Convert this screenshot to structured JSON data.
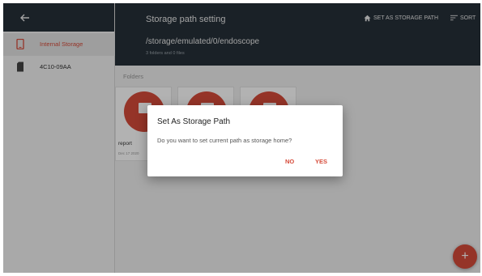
{
  "sidebar": {
    "items": [
      {
        "label": "Internal Storage",
        "icon": "phone-icon",
        "active": true
      },
      {
        "label": "4C10-09AA",
        "icon": "sd-card-icon",
        "active": false
      }
    ]
  },
  "header": {
    "title": "Storage path setting",
    "path": "/storage/emulated/0/endoscope",
    "subtitle": "3 folders and 0 files",
    "set_storage_label": "SET AS STORAGE PATH",
    "sort_label": "SORT"
  },
  "content": {
    "section_label": "Folders",
    "folders": [
      {
        "name": "report",
        "date": "Dec 17 2020"
      },
      {
        "name": "",
        "date": ""
      },
      {
        "name": "",
        "date": ""
      }
    ]
  },
  "fab": {
    "label": "+"
  },
  "dialog": {
    "title": "Set As Storage Path",
    "message": "Do you want to set current path as storage home?",
    "no_label": "NO",
    "yes_label": "YES"
  },
  "colors": {
    "accent": "#d64b3a",
    "header": "#263039",
    "sidebar": "#f2f2f2"
  }
}
